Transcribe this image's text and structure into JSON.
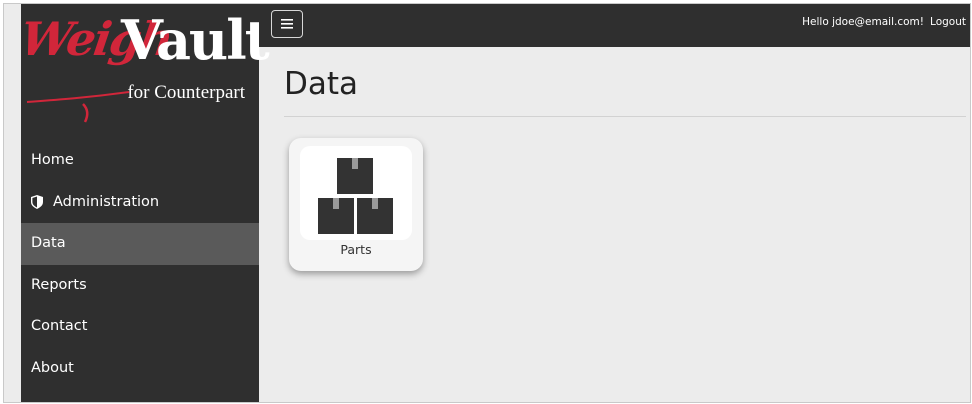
{
  "header": {
    "menu_icon": "hamburger-icon",
    "greeting": "Hello jdoe@email.com!",
    "logout_label": "Logout"
  },
  "logo": {
    "weigh": "Weigh",
    "vault": "Vault",
    "subtitle": "for Counterpart",
    "colors": {
      "weigh": "#d1263a",
      "vault": "#ffffff"
    }
  },
  "sidebar": {
    "items": [
      {
        "label": "Home",
        "icon": null,
        "active": false
      },
      {
        "label": "Administration",
        "icon": "shield-icon",
        "active": false
      },
      {
        "label": "Data",
        "icon": null,
        "active": true
      },
      {
        "label": "Reports",
        "icon": null,
        "active": false
      },
      {
        "label": "Contact",
        "icon": null,
        "active": false
      },
      {
        "label": "About",
        "icon": null,
        "active": false
      }
    ]
  },
  "main": {
    "title": "Data",
    "tiles": [
      {
        "label": "Parts",
        "icon": "boxes-icon"
      }
    ]
  },
  "colors": {
    "sidebar_bg": "#2f2f2f",
    "active_item_bg": "#5a5a5a",
    "content_bg": "#ececec"
  }
}
